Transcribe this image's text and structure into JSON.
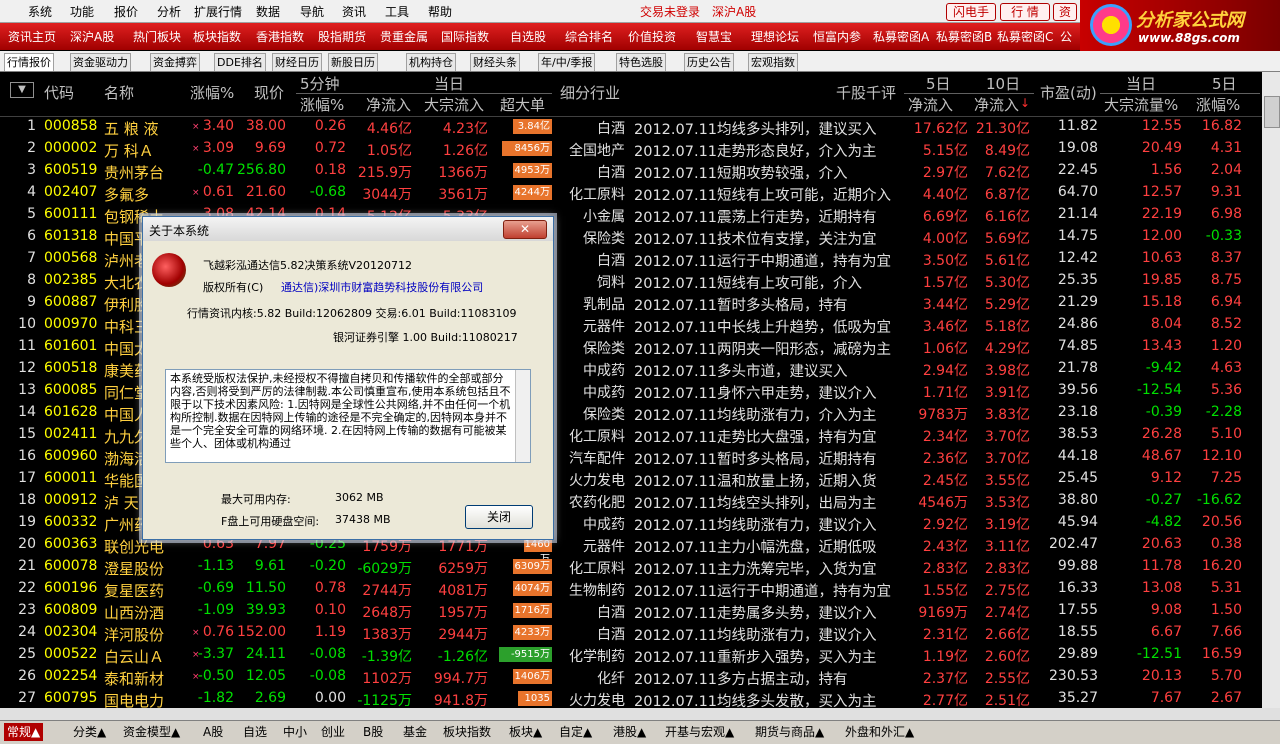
{
  "menu": {
    "items": [
      "系统",
      "功能",
      "报价",
      "分析",
      "扩展行情",
      "数据",
      "导航",
      "资讯",
      "工具",
      "帮助"
    ],
    "login_status": "交易未登录",
    "market": "深沪A股",
    "btn_flash": "闪电手",
    "btn_quote": "行 情",
    "btn_info": "资"
  },
  "logo": {
    "title": "分析家公式网",
    "url": "www.88gs.com"
  },
  "rednav": [
    "资讯主页",
    "深沪A股",
    "热门板块",
    "板块指数",
    "香港指数",
    "股指期货",
    "贵重金属",
    "国际指数",
    "自选股",
    "综合排名",
    "价值投资",
    "智慧宝",
    "理想论坛",
    "恒富内参",
    "私募密函A",
    "私募密函B",
    "私募密函C",
    "公"
  ],
  "subtabs": [
    "行情报价",
    "资金驱动力",
    "资金搏弈",
    "DDE排名",
    "财经日历",
    "新股日历",
    "机构持仓",
    "财经头条",
    "年/中/季报",
    "特色选股",
    "历史公告",
    "宏观指数"
  ],
  "header": {
    "code": "代码",
    "name": "名称",
    "chg": "涨幅%",
    "price": "现价",
    "min5": "5分钟",
    "min5_chg": "涨幅%",
    "today": "当日",
    "net_in": "净流入",
    "block_in": "大宗流入",
    "super": "超大单",
    "industry": "细分行业",
    "comment": "千股千评",
    "d5": "5日",
    "d5_net": "净流入",
    "d10": "10日",
    "d10_net": "净流入",
    "pe": "市盈(动)",
    "today2": "当日",
    "block_pct": "大宗流量%",
    "d5b": "5日",
    "d5_chg": "涨幅%"
  },
  "rows": [
    {
      "n": "1",
      "code": "000858",
      "name": "五 粮 液",
      "mark": "×",
      "chg": "3.40",
      "price": "38.00",
      "m5": "0.26",
      "net": "4.46亿",
      "blk": "4.23亿",
      "sup": "3.84亿",
      "sup_pct": 0.7,
      "sup_pos": true,
      "ind": "白酒",
      "cmt": "2012.07.11均线多头排列，建议买入",
      "d5": "17.62亿",
      "d10": "21.30亿",
      "pe": "11.82",
      "bp": "12.55",
      "d5c": "16.82"
    },
    {
      "n": "2",
      "code": "000002",
      "name": "万 科Ａ",
      "mark": "×",
      "chg": "3.09",
      "price": "9.69",
      "m5": "0.72",
      "net": "1.05亿",
      "blk": "1.26亿",
      "sup": "8456万",
      "sup_pct": 0.9,
      "sup_pos": true,
      "ind": "全国地产",
      "cmt": "2012.07.11走势形态良好，介入为主",
      "d5": "5.15亿",
      "d10": "8.49亿",
      "pe": "19.08",
      "bp": "20.49",
      "d5c": "4.31"
    },
    {
      "n": "3",
      "code": "600519",
      "name": "贵州茅台",
      "mark": "",
      "chg": "-0.47",
      "price": "256.80",
      "m5": "0.18",
      "net": "215.9万",
      "blk": "1366万",
      "sup": "4953万",
      "sup_pct": 0.7,
      "sup_pos": true,
      "ind": "白酒",
      "cmt": "2012.07.11短期攻势较强，介入",
      "d5": "2.97亿",
      "d10": "7.62亿",
      "pe": "22.45",
      "bp": "1.56",
      "d5c": "2.04"
    },
    {
      "n": "4",
      "code": "002407",
      "name": "多氟多",
      "mark": "×",
      "chg": "0.61",
      "price": "21.60",
      "m5": "-0.68",
      "net": "3044万",
      "blk": "3561万",
      "sup": "4244万",
      "sup_pct": 0.7,
      "sup_pos": true,
      "ind": "化工原料",
      "cmt": "2012.07.11短线有上攻可能，近期介入",
      "d5": "4.40亿",
      "d10": "6.87亿",
      "pe": "64.70",
      "bp": "12.57",
      "d5c": "9.31"
    },
    {
      "n": "5",
      "code": "600111",
      "name": "包钢稀土",
      "mark": "",
      "chg": "3.08",
      "price": "42.14",
      "m5": "0.14",
      "net": "5.12亿",
      "blk": "5.33亿",
      "sup": "",
      "sup_pct": 0,
      "sup_pos": true,
      "ind": "小金属",
      "cmt": "2012.07.11震荡上行走势，近期持有",
      "d5": "6.69亿",
      "d10": "6.16亿",
      "pe": "21.14",
      "bp": "22.19",
      "d5c": "6.98"
    },
    {
      "n": "6",
      "code": "601318",
      "name": "中国平安",
      "mark": "",
      "chg": "",
      "price": "",
      "m5": "",
      "net": "",
      "blk": "",
      "sup": "",
      "sup_pct": 0,
      "sup_pos": true,
      "ind": "保险类",
      "cmt": "2012.07.11技术位有支撑，关注为宜",
      "d5": "4.00亿",
      "d10": "5.69亿",
      "pe": "14.75",
      "bp": "12.00",
      "d5c": "-0.33"
    },
    {
      "n": "7",
      "code": "000568",
      "name": "泸州老窖",
      "mark": "",
      "chg": "",
      "price": "",
      "m5": "",
      "net": "",
      "blk": "",
      "sup": "",
      "sup_pct": 0,
      "sup_pos": true,
      "ind": "白酒",
      "cmt": "2012.07.11运行于中期通道，持有为宜",
      "d5": "3.50亿",
      "d10": "5.61亿",
      "pe": "12.42",
      "bp": "10.63",
      "d5c": "8.37"
    },
    {
      "n": "8",
      "code": "002385",
      "name": "大北农",
      "mark": "",
      "chg": "",
      "price": "",
      "m5": "",
      "net": "",
      "blk": "",
      "sup": "",
      "sup_pct": 0,
      "sup_pos": true,
      "ind": "饲料",
      "cmt": "2012.07.11短线有上攻可能，介入",
      "d5": "1.57亿",
      "d10": "5.30亿",
      "pe": "25.35",
      "bp": "19.85",
      "d5c": "8.75"
    },
    {
      "n": "9",
      "code": "600887",
      "name": "伊利股份",
      "mark": "",
      "chg": "",
      "price": "",
      "m5": "",
      "net": "",
      "blk": "",
      "sup": "",
      "sup_pct": 0,
      "sup_pos": true,
      "ind": "乳制品",
      "cmt": "2012.07.11暂时多头格局，持有",
      "d5": "3.44亿",
      "d10": "5.29亿",
      "pe": "21.29",
      "bp": "15.18",
      "d5c": "6.94"
    },
    {
      "n": "10",
      "code": "000970",
      "name": "中科三环",
      "mark": "",
      "chg": "",
      "price": "",
      "m5": "",
      "net": "",
      "blk": "",
      "sup": "",
      "sup_pct": 0,
      "sup_pos": true,
      "ind": "元器件",
      "cmt": "2012.07.11中长线上升趋势，低吸为宜",
      "d5": "3.46亿",
      "d10": "5.18亿",
      "pe": "24.86",
      "bp": "8.04",
      "d5c": "8.52"
    },
    {
      "n": "11",
      "code": "601601",
      "name": "中国太保",
      "mark": "",
      "chg": "",
      "price": "",
      "m5": "",
      "net": "",
      "blk": "",
      "sup": "",
      "sup_pct": 0,
      "sup_pos": true,
      "ind": "保险类",
      "cmt": "2012.07.11两阴夹一阳形态，减磅为主",
      "d5": "1.06亿",
      "d10": "4.29亿",
      "pe": "74.85",
      "bp": "13.43",
      "d5c": "1.20"
    },
    {
      "n": "12",
      "code": "600518",
      "name": "康美药业",
      "mark": "",
      "chg": "",
      "price": "",
      "m5": "",
      "net": "",
      "blk": "",
      "sup": "",
      "sup_pct": 0,
      "sup_pos": true,
      "ind": "中成药",
      "cmt": "2012.07.11多头市道，建议买入",
      "d5": "2.94亿",
      "d10": "3.98亿",
      "pe": "21.78",
      "bp": "-9.42",
      "d5c": "4.63"
    },
    {
      "n": "13",
      "code": "600085",
      "name": "同仁堂",
      "mark": "",
      "chg": "",
      "price": "",
      "m5": "",
      "net": "",
      "blk": "",
      "sup": "",
      "sup_pct": 0,
      "sup_pos": true,
      "ind": "中成药",
      "cmt": "2012.07.11身怀六甲走势，建议介入",
      "d5": "1.71亿",
      "d10": "3.91亿",
      "pe": "39.56",
      "bp": "-12.54",
      "d5c": "5.36"
    },
    {
      "n": "14",
      "code": "601628",
      "name": "中国人寿",
      "mark": "",
      "chg": "",
      "price": "",
      "m5": "",
      "net": "",
      "blk": "",
      "sup": "",
      "sup_pct": 0,
      "sup_pos": true,
      "ind": "保险类",
      "cmt": "2012.07.11均线助涨有力，介入为主",
      "d5": "9783万",
      "d10": "3.83亿",
      "pe": "23.18",
      "bp": "-0.39",
      "d5c": "-2.28"
    },
    {
      "n": "15",
      "code": "002411",
      "name": "九九久",
      "mark": "",
      "chg": "",
      "price": "",
      "m5": "",
      "net": "",
      "blk": "",
      "sup": "",
      "sup_pct": 0,
      "sup_pos": true,
      "ind": "化工原料",
      "cmt": "2012.07.11走势比大盘强，持有为宜",
      "d5": "2.34亿",
      "d10": "3.70亿",
      "pe": "38.53",
      "bp": "26.28",
      "d5c": "5.10"
    },
    {
      "n": "16",
      "code": "600960",
      "name": "渤海活塞",
      "mark": "",
      "chg": "",
      "price": "",
      "m5": "",
      "net": "",
      "blk": "",
      "sup": "",
      "sup_pct": 0,
      "sup_pos": true,
      "ind": "汽车配件",
      "cmt": "2012.07.11暂时多头格局，近期持有",
      "d5": "2.36亿",
      "d10": "3.70亿",
      "pe": "44.18",
      "bp": "48.67",
      "d5c": "12.10"
    },
    {
      "n": "17",
      "code": "600011",
      "name": "华能国际",
      "mark": "",
      "chg": "",
      "price": "",
      "m5": "",
      "net": "",
      "blk": "",
      "sup": "",
      "sup_pct": 0,
      "sup_pos": true,
      "ind": "火力发电",
      "cmt": "2012.07.11温和放量上扬，近期入货",
      "d5": "2.45亿",
      "d10": "3.55亿",
      "pe": "25.45",
      "bp": "9.12",
      "d5c": "7.25"
    },
    {
      "n": "18",
      "code": "000912",
      "name": "泸 天 化",
      "mark": "",
      "chg": "",
      "price": "",
      "m5": "",
      "net": "",
      "blk": "",
      "sup": "",
      "sup_pct": 0,
      "sup_pos": true,
      "ind": "农药化肥",
      "cmt": "2012.07.11均线空头排列，出局为主",
      "d5": "4546万",
      "d10": "3.53亿",
      "pe": "38.80",
      "bp": "-0.27",
      "d5c": "-16.62"
    },
    {
      "n": "19",
      "code": "600332",
      "name": "广州药业",
      "mark": "",
      "chg": "",
      "price": "",
      "m5": "",
      "net": "",
      "blk": "",
      "sup": "",
      "sup_pct": 0,
      "sup_pos": true,
      "ind": "中成药",
      "cmt": "2012.07.11均线助涨有力，建议介入",
      "d5": "2.92亿",
      "d10": "3.19亿",
      "pe": "45.94",
      "bp": "-4.82",
      "d5c": "20.56"
    },
    {
      "n": "20",
      "code": "600363",
      "name": "联创光电",
      "mark": "",
      "chg": "0.63",
      "price": "7.97",
      "m5": "-0.25",
      "net": "1759万",
      "blk": "1771万",
      "sup": "1460万",
      "sup_pct": 0.5,
      "sup_pos": true,
      "ind": "元器件",
      "cmt": "2012.07.11主力小幅洗盘，近期低吸",
      "d5": "2.43亿",
      "d10": "3.11亿",
      "pe": "202.47",
      "bp": "20.63",
      "d5c": "0.38"
    },
    {
      "n": "21",
      "code": "600078",
      "name": "澄星股份",
      "mark": "",
      "chg": "-1.13",
      "price": "9.61",
      "m5": "-0.20",
      "net": "-6029万",
      "blk": "6259万",
      "sup": "6309万",
      "sup_pct": 0.7,
      "sup_pos": true,
      "ind": "化工原料",
      "cmt": "2012.07.11主力洗筹完毕，入货为宜",
      "d5": "2.83亿",
      "d10": "2.83亿",
      "pe": "99.88",
      "bp": "11.78",
      "d5c": "16.20"
    },
    {
      "n": "22",
      "code": "600196",
      "name": "复星医药",
      "mark": "",
      "chg": "-0.69",
      "price": "11.50",
      "m5": "0.78",
      "net": "2744万",
      "blk": "4081万",
      "sup": "4074万",
      "sup_pct": 0.7,
      "sup_pos": true,
      "ind": "生物制药",
      "cmt": "2012.07.11运行于中期通道，持有为宜",
      "d5": "1.55亿",
      "d10": "2.75亿",
      "pe": "16.33",
      "bp": "13.08",
      "d5c": "5.31"
    },
    {
      "n": "23",
      "code": "600809",
      "name": "山西汾酒",
      "mark": "",
      "chg": "-1.09",
      "price": "39.93",
      "m5": "0.10",
      "net": "2648万",
      "blk": "1957万",
      "sup": "1716万",
      "sup_pct": 0.7,
      "sup_pos": true,
      "ind": "白酒",
      "cmt": "2012.07.11走势属多头势，建议介入",
      "d5": "9169万",
      "d10": "2.74亿",
      "pe": "17.55",
      "bp": "9.08",
      "d5c": "1.50"
    },
    {
      "n": "24",
      "code": "002304",
      "name": "洋河股份",
      "mark": "×",
      "chg": "0.76",
      "price": "152.00",
      "m5": "1.19",
      "net": "1383万",
      "blk": "2944万",
      "sup": "4233万",
      "sup_pct": 0.7,
      "sup_pos": true,
      "ind": "白酒",
      "cmt": "2012.07.11均线助涨有力，建议介入",
      "d5": "2.31亿",
      "d10": "2.66亿",
      "pe": "18.55",
      "bp": "6.67",
      "d5c": "7.66"
    },
    {
      "n": "25",
      "code": "000522",
      "name": "白云山Ａ",
      "mark": "×",
      "chg": "-3.37",
      "price": "24.11",
      "m5": "-0.08",
      "net": "-1.39亿",
      "blk": "-1.26亿",
      "sup": "-9515万",
      "sup_pct": 0.95,
      "sup_pos": false,
      "ind": "化学制药",
      "cmt": "2012.07.11重新步入强势，买入为主",
      "d5": "1.19亿",
      "d10": "2.60亿",
      "pe": "29.89",
      "bp": "-12.51",
      "d5c": "16.59"
    },
    {
      "n": "26",
      "code": "002254",
      "name": "泰和新材",
      "mark": "×",
      "chg": "-0.50",
      "price": "12.05",
      "m5": "-0.08",
      "net": "1102万",
      "blk": "994.7万",
      "sup": "1406万",
      "sup_pct": 0.7,
      "sup_pos": true,
      "ind": "化纤",
      "cmt": "2012.07.11多方占据主动，持有",
      "d5": "2.37亿",
      "d10": "2.55亿",
      "pe": "230.53",
      "bp": "20.13",
      "d5c": "5.70"
    },
    {
      "n": "27",
      "code": "600795",
      "name": "国电电力",
      "mark": "",
      "chg": "-1.82",
      "price": "2.69",
      "m5": "0.00",
      "net": "-1125万",
      "blk": "941.8万",
      "sup": "1035万",
      "sup_pct": 0.6,
      "sup_pos": true,
      "ind": "火力发电",
      "cmt": "2012.07.11均线多头发散，买入为主",
      "d5": "2.77亿",
      "d10": "2.51亿",
      "pe": "35.27",
      "bp": "7.67",
      "d5c": "2.67"
    }
  ],
  "bottom": [
    "常规▲",
    "分类▲",
    "资金模型▲",
    "A股",
    "自选",
    "中小",
    "创业",
    "B股",
    "基金",
    "板块指数",
    "板块▲",
    "自定▲",
    "港股▲",
    "开基与宏观▲",
    "期货与商品▲",
    "外盘和外汇▲"
  ],
  "dialog": {
    "title": "关于本系统",
    "close_label": "✕",
    "product": "飞越彩泓通达信5.82决策系统V20120712",
    "copyright_label": "版权所有(C)",
    "copyright_holder": "通达信)深圳市财富趋势科技股份有限公司",
    "core": "行情资讯内核:5.82 Build:12062809  交易:6.01 Build:11083109",
    "engine": "银河证券引擎 1.00 Build:11080217",
    "text": "本系统受版权法保护,未经授权不得擅自拷贝和传播软件的全部或部分内容,否则将受到严厉的法律制裁.本公司慎重宣布,使用本系统包括且不限于以下技术因素风险: 1.因特网是全球性公共网络,并不由任何一个机构所控制.数据在因特网上传输的途径是不完全确定的,因特网本身并不是一个完全安全可靠的网络环境. 2.在因特网上传输的数据有可能被某些个人、团体或机构通过",
    "mem_label": "最大可用内存:",
    "mem_value": "3062 MB",
    "disk_label": "F盘上可用硬盘空间:",
    "disk_value": "37438 MB",
    "ok_label": "关闭"
  },
  "colors": {
    "up": "#ff4040",
    "down": "#00e000",
    "box_up": "#e8742c",
    "box_down": "#2ca02c"
  }
}
